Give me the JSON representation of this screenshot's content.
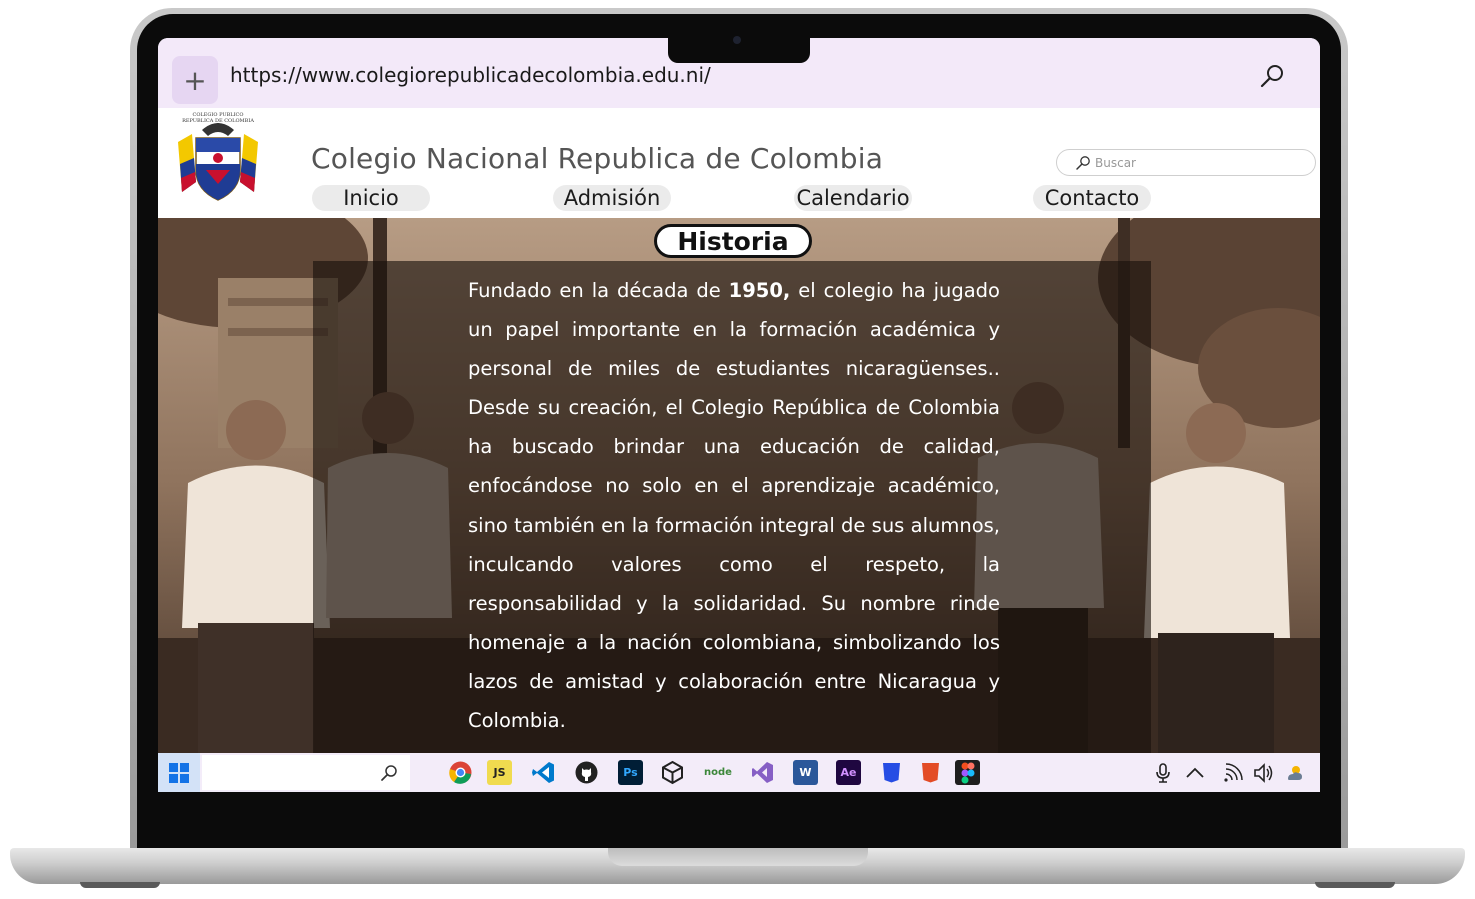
{
  "browser": {
    "new_tab_symbol": "+",
    "url": "https://www.colegiorepublicadecolombia.edu.ni/"
  },
  "site": {
    "logo_caption_line1": "COLEGIO PUBLICO",
    "logo_caption_line2": "REPUBLICA DE COLOMBIA",
    "title": "Colegio Nacional Republica de Colombia",
    "search_placeholder": "Buscar",
    "nav": [
      {
        "label": "Inicio"
      },
      {
        "label": "Admisión"
      },
      {
        "label": "Calendario"
      },
      {
        "label": "Contacto"
      }
    ]
  },
  "hero": {
    "badge": "Historia",
    "history_lead": "Fundado en la década de ",
    "history_year": "1950,",
    "history_body": " el colegio ha jugado un papel importante en la formación académica y personal de miles de estudiantes nicaragüenses.. Desde su creación, el Colegio República de Colombia ha buscado brindar una educación de calidad, enfocándose no solo en el aprendizaje académico, sino también en la formación integral de sus alumnos, inculcando valores como el respeto, la responsabilidad y la solidaridad. Su nombre rinde homenaje a la nación colombiana, simbolizando los lazos de amistad y colaboración entre Nicaragua y Colombia."
  },
  "taskbar": {
    "apps": [
      {
        "icon": "chrome-icon",
        "label": ""
      },
      {
        "icon": "javascript-icon",
        "label": "JS"
      },
      {
        "icon": "vscode-icon",
        "label": ""
      },
      {
        "icon": "github-icon",
        "label": ""
      },
      {
        "icon": "photoshop-icon",
        "label": "Ps"
      },
      {
        "icon": "unity-icon",
        "label": ""
      },
      {
        "icon": "nodejs-icon",
        "label": "node"
      },
      {
        "icon": "visual-studio-icon",
        "label": ""
      },
      {
        "icon": "word-icon",
        "label": "W"
      },
      {
        "icon": "after-effects-icon",
        "label": "Ae"
      },
      {
        "icon": "css3-icon",
        "label": "3"
      },
      {
        "icon": "html5-icon",
        "label": "5"
      },
      {
        "icon": "figma-icon",
        "label": ""
      }
    ],
    "colors": {
      "start": "#1473e6",
      "chrome": "#db4437",
      "javascript": "#f0db4f",
      "vscode": "#007acc",
      "photoshop": "#001e36",
      "node": "#3c873a",
      "visual_studio": "#865fc5",
      "word": "#2b579a",
      "after_effects": "#1f0740",
      "css3": "#264de4",
      "html5": "#e34c26"
    }
  }
}
